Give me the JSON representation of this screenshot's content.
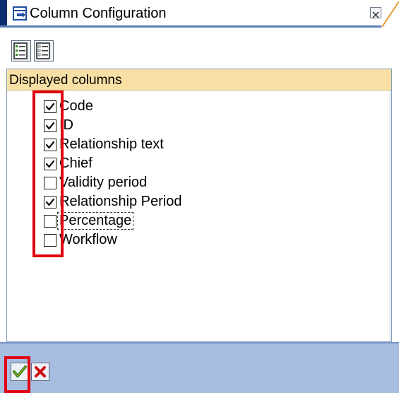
{
  "window": {
    "title": "Column Configuration",
    "icons": {
      "title": "column-config-icon",
      "close": "close-icon"
    }
  },
  "toolbar": {
    "buttons": [
      {
        "name": "select-all-icon"
      },
      {
        "name": "deselect-all-icon"
      }
    ]
  },
  "list": {
    "header": "Displayed columns",
    "items": [
      {
        "label": "Code",
        "checked": true
      },
      {
        "label": "ID",
        "checked": true
      },
      {
        "label": "Relationship text",
        "checked": true
      },
      {
        "label": "Chief",
        "checked": true
      },
      {
        "label": "Validity period",
        "checked": false
      },
      {
        "label": "Relationship Period",
        "checked": true
      },
      {
        "label": "Percentage",
        "checked": false,
        "focused": true
      },
      {
        "label": "Workflow",
        "checked": false
      }
    ]
  },
  "footer": {
    "confirm_icon": "checkmark-icon",
    "cancel_icon": "cancel-x-icon"
  },
  "colors": {
    "header_bg": "#f8e0a4",
    "footer_bg": "#a7bde0",
    "highlight": "#e00010",
    "confirm": "#2a8a1a",
    "cancel": "#d01010"
  }
}
